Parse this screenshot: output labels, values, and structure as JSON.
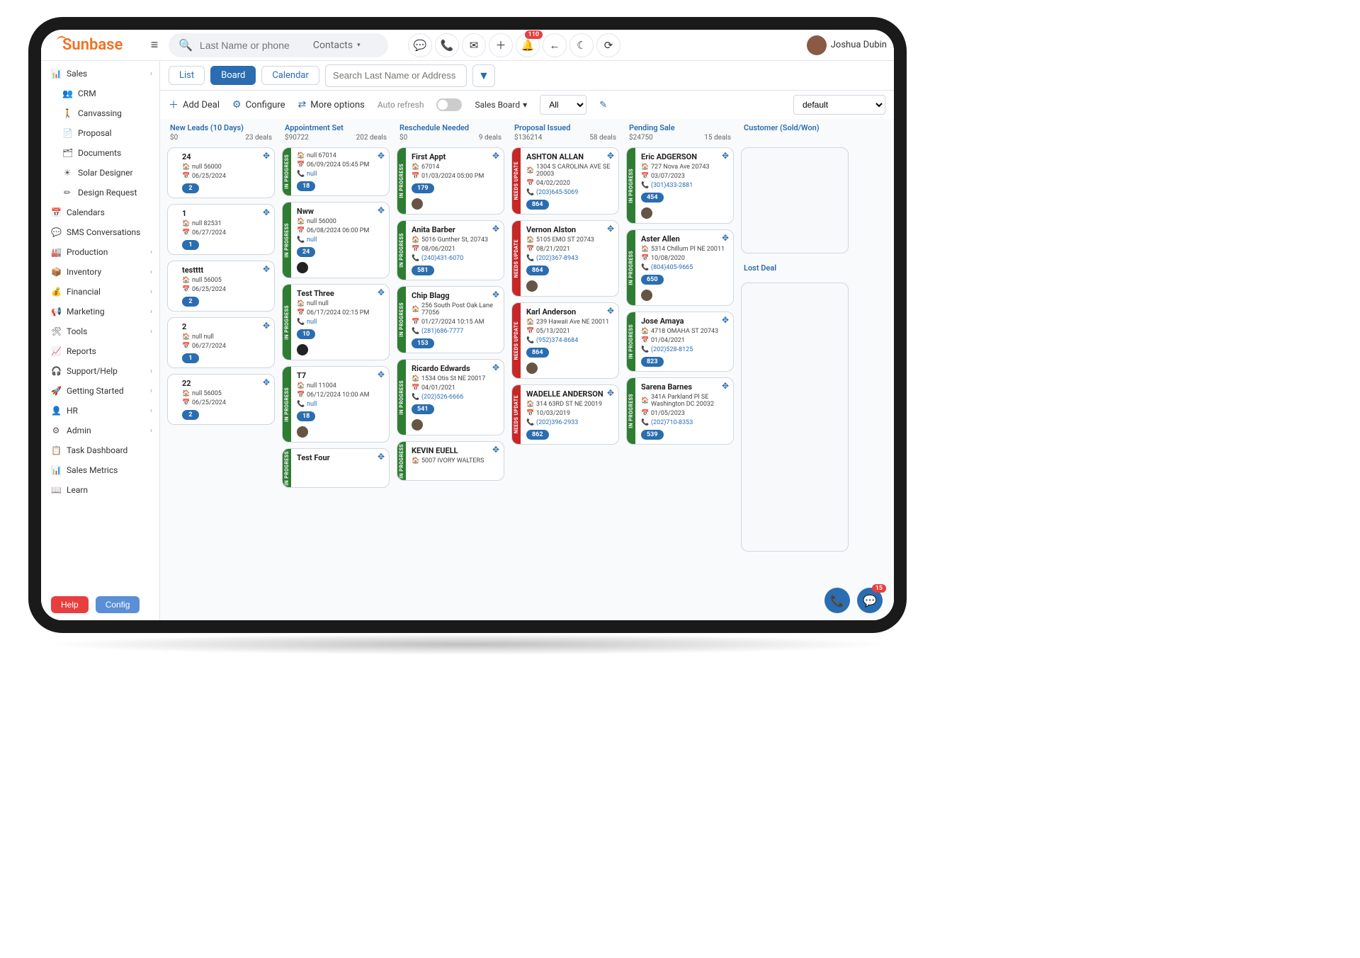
{
  "brand": "Sunbase",
  "user": "Joshua Dubin",
  "search_placeholder": "Last Name or phone",
  "search_type": "Contacts",
  "notif_count": "110",
  "nav": [
    {
      "label": "Sales",
      "ico": "📊",
      "exp": true
    },
    {
      "label": "CRM",
      "ico": "👥",
      "sub": true
    },
    {
      "label": "Canvassing",
      "ico": "🚶",
      "sub": true
    },
    {
      "label": "Proposal",
      "ico": "📄",
      "sub": true
    },
    {
      "label": "Documents",
      "ico": "🗂",
      "sub": true
    },
    {
      "label": "Solar Designer",
      "ico": "☀",
      "sub": true
    },
    {
      "label": "Design Request",
      "ico": "✏",
      "sub": true
    },
    {
      "label": "Calendars",
      "ico": "📅"
    },
    {
      "label": "SMS Conversations",
      "ico": "💬"
    },
    {
      "label": "Production",
      "ico": "🏭",
      "exp": true
    },
    {
      "label": "Inventory",
      "ico": "📦",
      "exp": true
    },
    {
      "label": "Financial",
      "ico": "💰",
      "exp": true
    },
    {
      "label": "Marketing",
      "ico": "📢",
      "exp": true
    },
    {
      "label": "Tools",
      "ico": "🛠",
      "exp": true
    },
    {
      "label": "Reports",
      "ico": "📈"
    },
    {
      "label": "Support/Help",
      "ico": "🎧",
      "exp": true
    },
    {
      "label": "Getting Started",
      "ico": "🚀",
      "exp": true
    },
    {
      "label": "HR",
      "ico": "👤",
      "exp": true
    },
    {
      "label": "Admin",
      "ico": "⚙",
      "exp": true
    },
    {
      "label": "Task Dashboard",
      "ico": "📋"
    },
    {
      "label": "Sales Metrics",
      "ico": "📊"
    },
    {
      "label": "Learn",
      "ico": "📖"
    }
  ],
  "views": {
    "list": "List",
    "board": "Board",
    "calendar": "Calendar"
  },
  "search2_placeholder": "Search Last Name or Address",
  "tools": {
    "add": "Add Deal",
    "config": "Configure",
    "more": "More options",
    "auto": "Auto refresh",
    "board_sel": "Sales Board",
    "filter_all": "All",
    "preset": "default"
  },
  "columns": [
    {
      "title": "New Leads (10 Days)",
      "sum": "$0",
      "count": "23 deals",
      "cards": [
        {
          "name": "24",
          "addr": "null 56000",
          "date": "06/25/2024",
          "badge": "2"
        },
        {
          "name": "1",
          "addr": "null 82531",
          "date": "06/27/2024",
          "badge": "1"
        },
        {
          "name": "testttt",
          "addr": "null 56005",
          "date": "06/25/2024",
          "badge": "2"
        },
        {
          "name": "2",
          "addr": "null null",
          "date": "06/27/2024",
          "badge": "1"
        },
        {
          "name": "22",
          "addr": "null 56005",
          "date": "06/25/2024",
          "badge": "2"
        }
      ]
    },
    {
      "title": "Appointment Set",
      "sum": "$90722",
      "count": "202 deals",
      "rail": "green",
      "railtxt": "IN PROGRESS",
      "cards": [
        {
          "name": "",
          "addr": "null 67014",
          "date": "06/09/2024 05:45 PM",
          "phone": "null",
          "badge": "18"
        },
        {
          "name": "Nww",
          "addr": "null 56000",
          "date": "06/08/2024 06:00 PM",
          "phone": "null",
          "badge": "24",
          "dot": true
        },
        {
          "name": "Test Three",
          "addr": "null null",
          "date": "06/17/2024 02:15 PM",
          "phone": "null",
          "badge": "10",
          "dot": true
        },
        {
          "name": "T7",
          "addr": "null 11004",
          "date": "06/12/2024 10:00 AM",
          "phone": "null",
          "badge": "18",
          "av": true
        },
        {
          "name": "Test Four"
        }
      ]
    },
    {
      "title": "Reschedule Needed",
      "sum": "$0",
      "count": "9 deals",
      "rail": "green",
      "railtxt": "IN PROGRESS",
      "cards": [
        {
          "name": "First Appt",
          "addr": "67014",
          "date": "01/03/2024 05:00 PM",
          "badge": "179",
          "av": true
        },
        {
          "name": "Anita Barber",
          "addr": "5016 Gunther St, 20743",
          "date": "08/06/2021",
          "phone": "(240)431-6070",
          "badge": "581"
        },
        {
          "name": "Chip Blagg",
          "addr": "256 South Post Oak Lane 77056",
          "date": "01/27/2024 10:15 AM",
          "phone": "(281)686-7777",
          "badge": "153"
        },
        {
          "name": "Ricardo Edwards",
          "addr": "1534 Otis St NE 20017",
          "date": "04/01/2021",
          "phone": "(202)526-6666",
          "badge": "541",
          "av": true
        },
        {
          "name": "KEVIN EUELL",
          "addr": "5007 IVORY WALTERS"
        }
      ]
    },
    {
      "title": "Proposal Issued",
      "sum": "$136214",
      "count": "58 deals",
      "rail": "red",
      "railtxt": "NEEDS UPDATE",
      "cards": [
        {
          "name": "ASHTON ALLAN",
          "addr": "1304 S CAROLINA AVE SE 20003",
          "date": "04/02/2020",
          "phone": "(203)645-5069",
          "badge": "864"
        },
        {
          "name": "Vernon Alston",
          "addr": "5105 EMO ST 20743",
          "date": "08/21/2021",
          "phone": "(202)367-8943",
          "badge": "864",
          "av": true
        },
        {
          "name": "Karl Anderson",
          "addr": "239 Hawaii Ave NE 20011",
          "date": "05/13/2021",
          "phone": "(952)374-8684",
          "badge": "864",
          "av": true
        },
        {
          "name": "WADELLE ANDERSON",
          "addr": "314 63RD ST NE 20019",
          "date": "10/03/2019",
          "phone": "(202)396-2933",
          "badge": "862"
        }
      ]
    },
    {
      "title": "Pending Sale",
      "sum": "$24750",
      "count": "15 deals",
      "rail": "green",
      "railtxt": "IN PROGRESS",
      "cards": [
        {
          "name": "Eric ADGERSON",
          "addr": "727 Nova Ave 20743",
          "date": "03/07/2023",
          "phone": "(301)433-2881",
          "badge": "454",
          "av": true
        },
        {
          "name": "Aster Allen",
          "addr": "5314 Chillum Pl NE 20011",
          "date": "10/08/2020",
          "phone": "(804)405-9665",
          "badge": "650",
          "av": true
        },
        {
          "name": "Jose Amaya",
          "addr": "4718 OMAHA ST 20743",
          "date": "01/04/2021",
          "phone": "(202)528-8125",
          "badge": "823"
        },
        {
          "name": "Sarena Barnes",
          "addr": "341A Parkland Pl SE Washington DC 20032",
          "date": "01/05/2023",
          "phone": "(202)710-8353",
          "badge": "539"
        }
      ]
    },
    {
      "title": "Customer (Sold/Won)",
      "sum": "",
      "count": "",
      "cards": []
    }
  ],
  "lost_label": "Lost Deal",
  "help": "Help",
  "config": "Config",
  "fab_badge": "15"
}
